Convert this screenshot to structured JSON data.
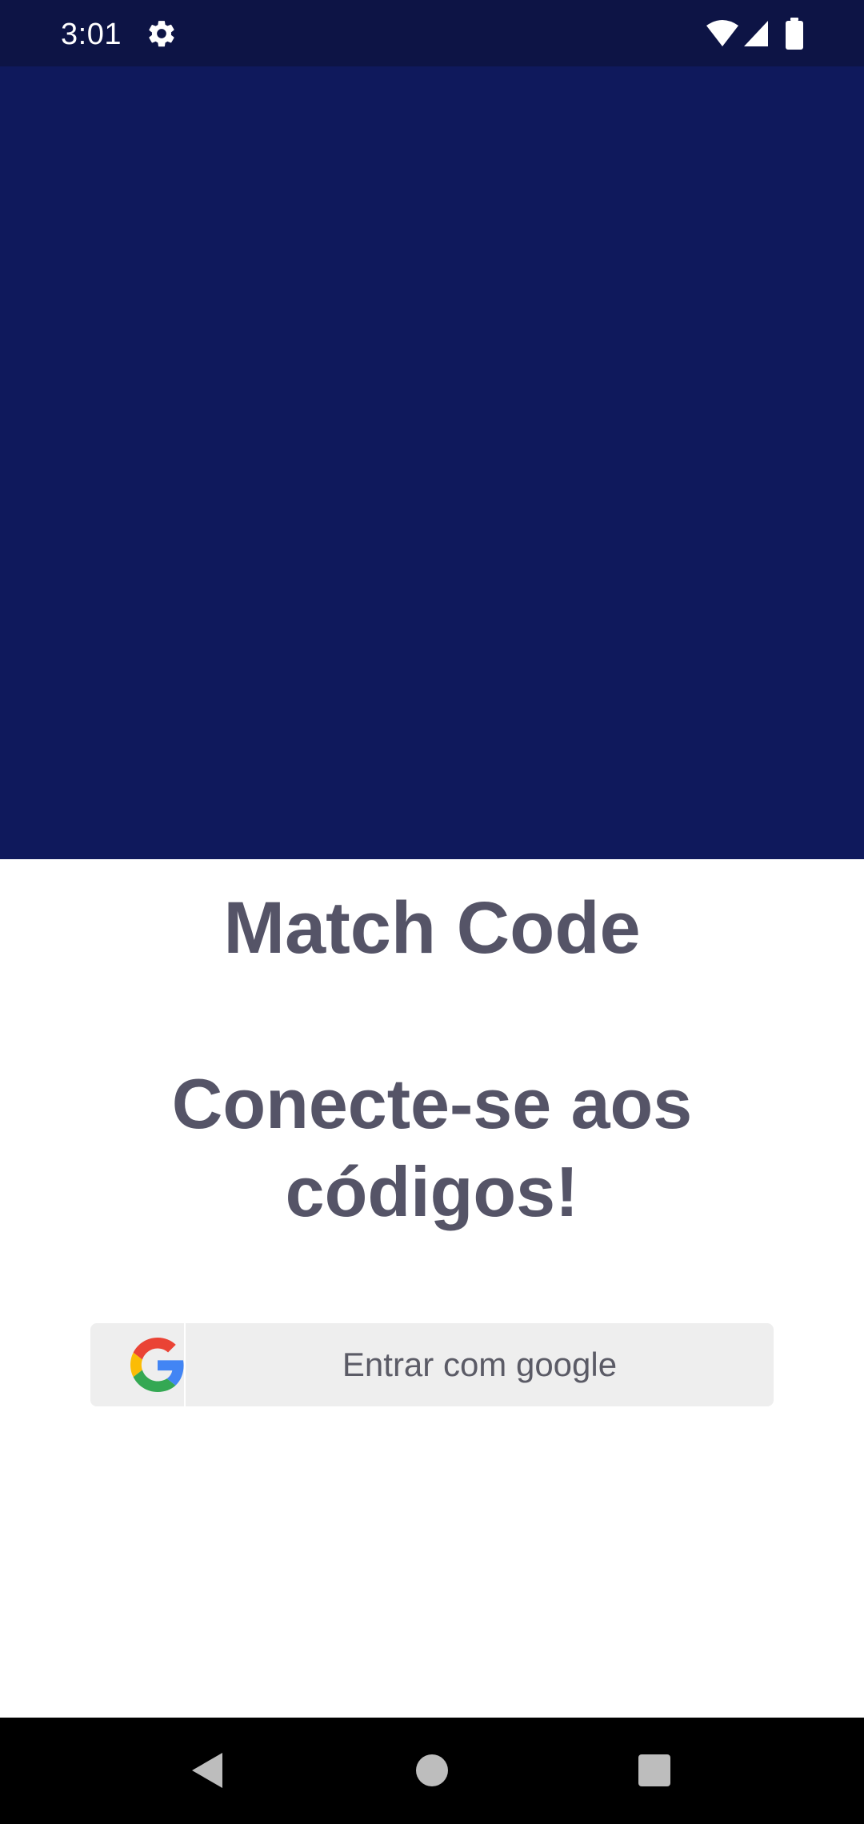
{
  "status_bar": {
    "time": "3:01",
    "icons": [
      "gear-icon",
      "wifi-icon",
      "signal-icon",
      "battery-icon"
    ]
  },
  "hero": {
    "background_color": "#0f195c"
  },
  "main": {
    "app_title": "Match Code",
    "tagline": "Conecte-se aos códigos!",
    "google_button": {
      "label": "Entrar com google",
      "icon": "google-logo-icon"
    }
  },
  "nav_bar": {
    "icons": [
      "back-icon",
      "home-icon",
      "recents-icon"
    ]
  },
  "colors": {
    "status_bar": "#0d1445",
    "hero": "#0f195c",
    "title_text": "#555467",
    "button_bg": "#eeeeee"
  }
}
